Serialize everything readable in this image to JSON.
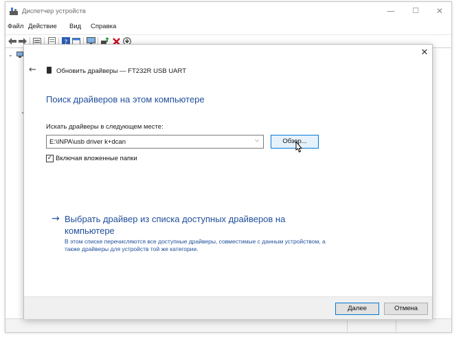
{
  "window": {
    "title": "Диспетчер устройств",
    "icon": "device-manager-icon",
    "controls": {
      "minimize": "—",
      "maximize": "☐",
      "close": "✕"
    }
  },
  "menu": {
    "file": "Файл",
    "action": "Действие",
    "view": "Вид",
    "help": "Справка"
  },
  "toolbar": {
    "icons": [
      "back-arrow-icon",
      "forward-arrow-icon",
      "properties-icon",
      "list-icon",
      "help-icon",
      "details-icon",
      "monitor-icon",
      "update-driver-icon",
      "uninstall-icon",
      "download-icon"
    ]
  },
  "dialog": {
    "close_glyph": "✕",
    "back_glyph": "←",
    "header": "Обновить драйверы — FT232R USB UART",
    "heading": "Поиск драйверов на этом компьютере",
    "path_label": "Искать драйверы в следующем месте:",
    "path_value": "E:\\INPA\\usb driver k+dcan",
    "browse_label": "Обзор...",
    "include_subfolders_label": "Включая вложенные папки",
    "include_subfolders_checked": true,
    "check_glyph": "✓",
    "pick_arrow": "→",
    "pick_title": "Выбрать драйвер из списка доступных драйверов на компьютере",
    "pick_desc": "В этом списке перечисляются все доступные драйверы, совместимые с данным устройством, а также драйверы для устройств той же категории.",
    "next_label": "Далее",
    "cancel_label": "Отмена"
  },
  "colors": {
    "accent_blue": "#1f4e9b",
    "focus_border": "#0078d7",
    "error_red": "#d0021b"
  }
}
